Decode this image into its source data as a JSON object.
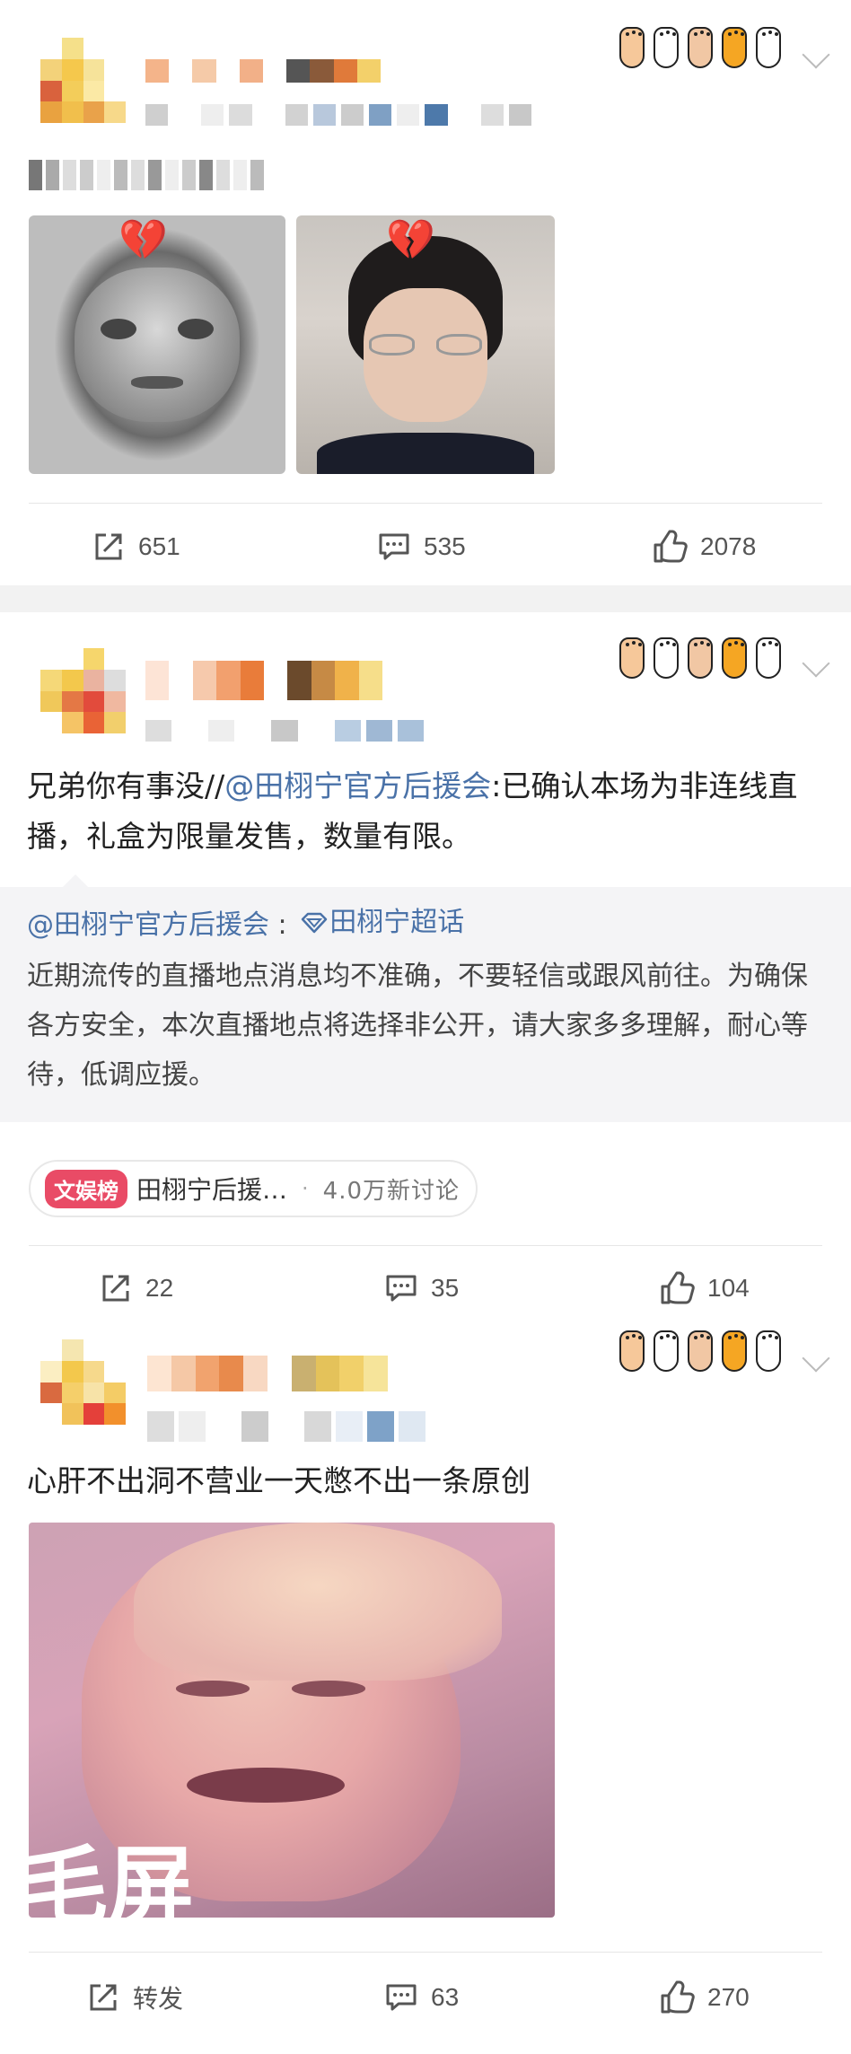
{
  "colors": {
    "link": "#4a72a8",
    "badge": "#e94b66",
    "background": "#f2f2f2"
  },
  "posts": [
    {
      "text_obscured": true,
      "images": [
        {
          "subject": "grey blurred cartoon face",
          "overlay_emoji": "💔"
        },
        {
          "subject": "young man with glasses",
          "overlay_emoji": "💔"
        }
      ],
      "actions": {
        "share": "651",
        "comment": "535",
        "like": "2078"
      }
    },
    {
      "text_prefix": "兄弟你有事没//",
      "text_mention": "@田栩宁官方后援会",
      "text_suffix": ":已确认本场为非连线直播，礼盒为限量发售，数量有限。",
      "repost": {
        "author": "@田栩宁官方后援会",
        "separator": " :",
        "topic": "田栩宁超话",
        "body": "近期流传的直播地点消息均不准确，不要轻信或跟风前往。为确保各方安全，本次直播地点将选择非公开，请大家多多理解，耐心等待，低调应援。"
      },
      "topic_chip": {
        "badge": "文娱榜",
        "name": "田栩宁后援…",
        "dot": "·",
        "count": "4.0万新讨论"
      },
      "actions": {
        "share": "22",
        "comment": "35",
        "like": "104"
      }
    },
    {
      "text": "心肝不出洞不营业一天憋不出一条原创",
      "images": [
        {
          "subject": "pink-tinted blurred face meme",
          "caption_fragment": "毛屏"
        }
      ],
      "actions": {
        "share": "转发",
        "comment": "63",
        "like": "270"
      }
    }
  ]
}
